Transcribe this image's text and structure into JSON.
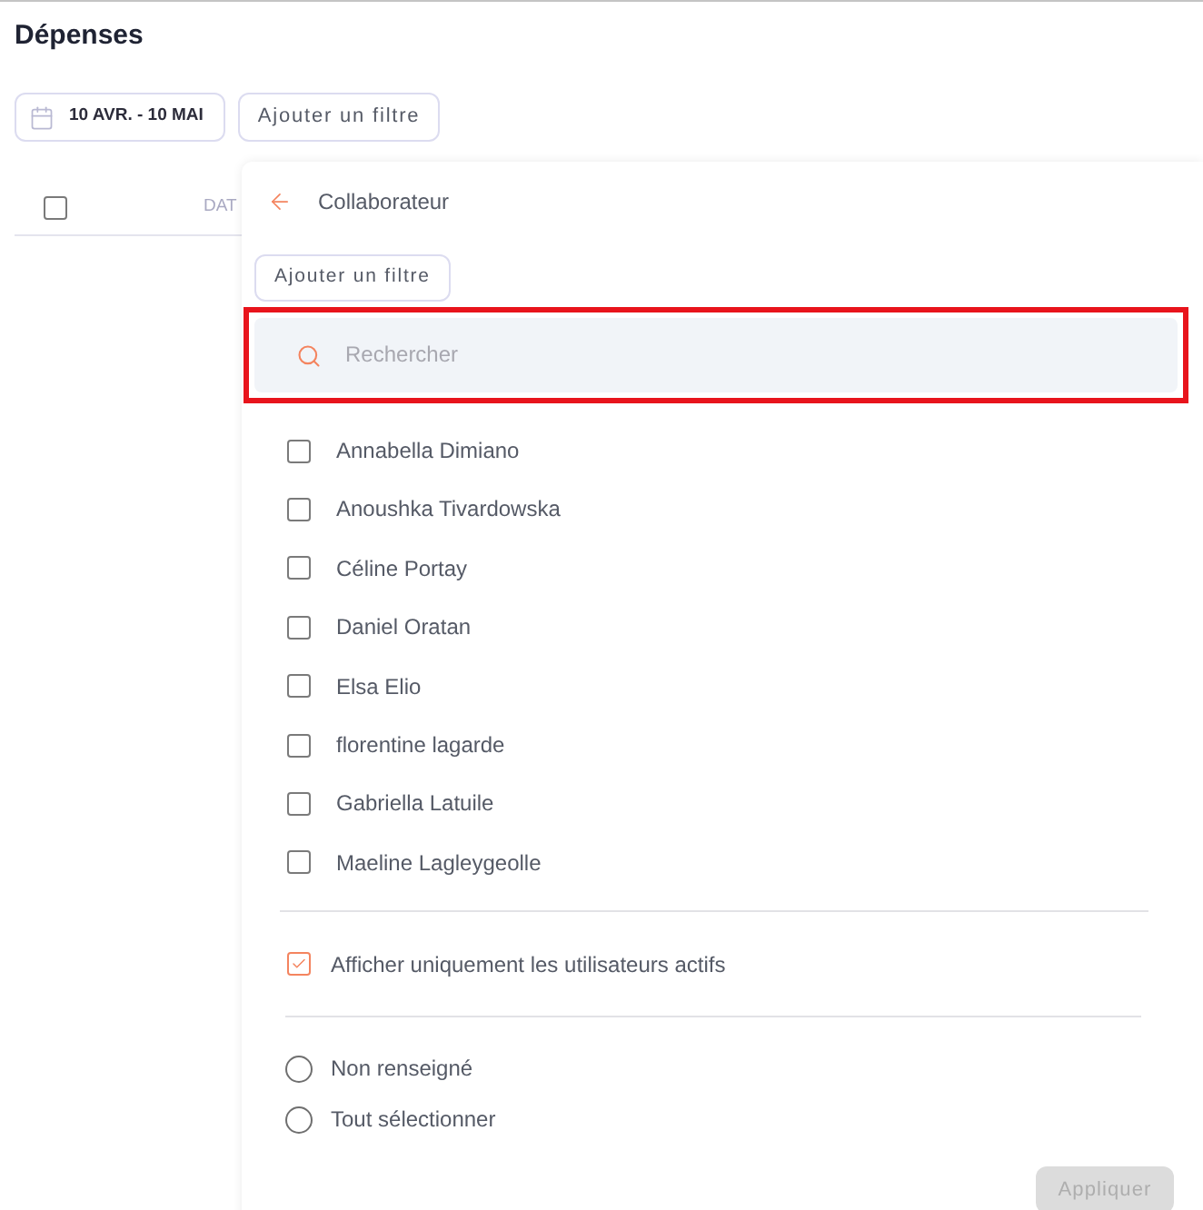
{
  "page": {
    "title": "Dépenses"
  },
  "toolbar": {
    "date_range": "10 AVR. - 10 MAI",
    "add_filter": "Ajouter un filtre"
  },
  "table": {
    "header_checkbox": {
      "checked": false
    },
    "columns": [
      "DAT"
    ]
  },
  "filter_panel": {
    "title": "Collaborateur",
    "add_filter": "Ajouter un filtre",
    "search": {
      "placeholder": "Rechercher",
      "highlighted": true
    },
    "people": [
      {
        "name": "Annabella Dimiano",
        "checked": false
      },
      {
        "name": "Anoushka Tivardowska",
        "checked": false
      },
      {
        "name": "Céline Portay",
        "checked": false
      },
      {
        "name": "Daniel Oratan",
        "checked": false
      },
      {
        "name": "Elsa Elio",
        "checked": false
      },
      {
        "name": "florentine lagarde",
        "checked": false
      },
      {
        "name": "Gabriella Latuile",
        "checked": false
      },
      {
        "name": "Maeline Lagleygeolle",
        "checked": false
      }
    ],
    "active_only": {
      "label": "Afficher uniquement les utilisateurs actifs",
      "checked": true
    },
    "options": [
      {
        "label": "Non renseigné",
        "selected": false
      },
      {
        "label": "Tout sélectionner",
        "selected": false
      }
    ],
    "apply": {
      "label": "Appliquer",
      "disabled": true
    }
  }
}
